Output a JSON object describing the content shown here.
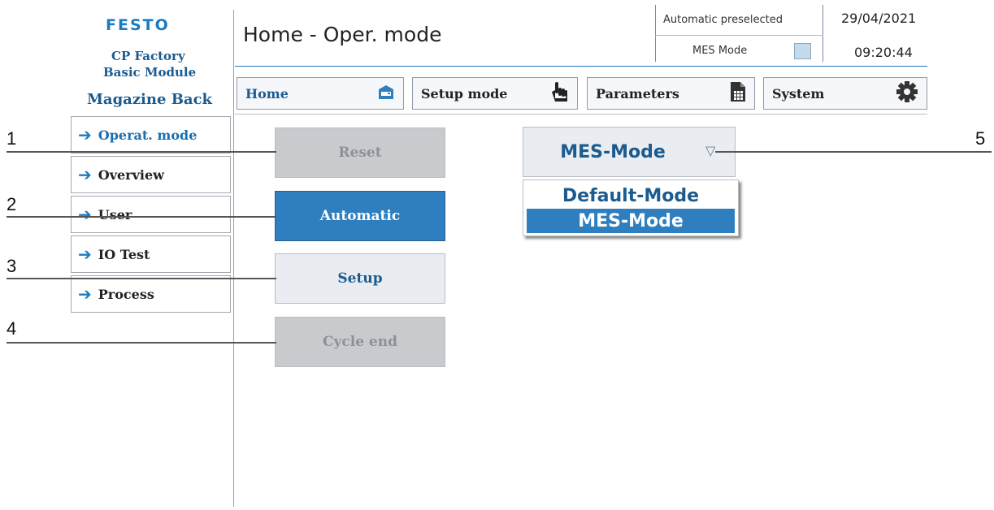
{
  "brand": {
    "logo": "FESTO",
    "line1": "CP Factory",
    "line2": "Basic Module",
    "line3": "Magazine Back"
  },
  "header": {
    "title": "Home - Oper. mode",
    "status_top": "Automatic preselected",
    "status_bottom": "MES Mode",
    "date": "29/04/2021",
    "time": "09:20:44"
  },
  "nav": {
    "home": "Home",
    "setup": "Setup mode",
    "parameters": "Parameters",
    "system": "System"
  },
  "sidebar": {
    "items": [
      {
        "label": "Operat. mode",
        "active": true
      },
      {
        "label": "Overview"
      },
      {
        "label": "User"
      },
      {
        "label": "IO Test"
      },
      {
        "label": "Process"
      }
    ]
  },
  "buttons": {
    "reset": "Reset",
    "automatic": "Automatic",
    "setup": "Setup",
    "cycle_end": "Cycle end"
  },
  "dropdown": {
    "selected": "MES-Mode",
    "options": [
      "Default-Mode",
      "MES-Mode"
    ]
  },
  "callouts": [
    "1",
    "2",
    "3",
    "4",
    "5"
  ],
  "colors": {
    "accent": "#2f7fc0",
    "brand_blue": "#1b5b8f",
    "disabled_bg": "#c8cacd"
  }
}
